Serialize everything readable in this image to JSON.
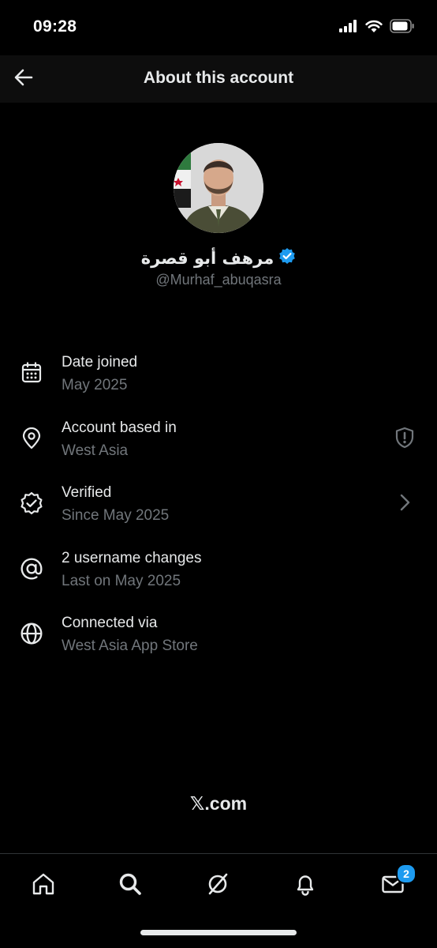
{
  "status_bar": {
    "time": "09:28",
    "icons": [
      "cellular-signal-icon",
      "wifi-icon",
      "battery-icon"
    ]
  },
  "header": {
    "title": "About this account",
    "back_icon": "arrow-left-icon"
  },
  "profile": {
    "display_name": "مرهف أبو قصرة",
    "handle": "@Murhaf_abuqasra",
    "verified_icon": "verified-badge-icon",
    "verified_color": "#1d9bf0"
  },
  "info": [
    {
      "icon": "calendar-icon",
      "title": "Date joined",
      "subtitle": "May 2025"
    },
    {
      "icon": "location-pin-icon",
      "title": "Account based in",
      "subtitle": "West Asia",
      "trailing_icon": "shield-alert-icon"
    },
    {
      "icon": "verified-outline-icon",
      "title": "Verified",
      "subtitle": "Since May 2025",
      "trailing_icon": "chevron-right-icon"
    },
    {
      "icon": "at-sign-icon",
      "title": "2 username changes",
      "subtitle": "Last on May 2025"
    },
    {
      "icon": "globe-icon",
      "title": "Connected via",
      "subtitle": "West Asia App Store"
    }
  ],
  "footer": {
    "brand": "𝕏.com"
  },
  "bottom_nav": {
    "items": [
      "home-icon",
      "search-icon",
      "grok-icon",
      "notifications-icon",
      "messages-icon"
    ],
    "messages_badge": "2"
  },
  "colors": {
    "background": "#000000",
    "text_primary": "#e7e9ea",
    "text_secondary": "#71767b",
    "accent": "#1d9bf0"
  }
}
